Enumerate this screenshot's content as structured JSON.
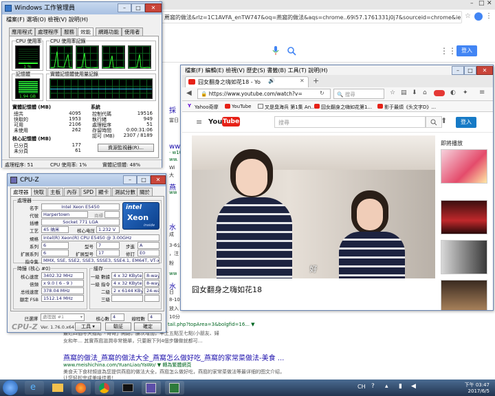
{
  "background": {
    "url": "薦窩的做法&rlz=1C1AVFA_enTW747&oq=燕窩的做法&aqs=chrome..69i57.1761331j0j7&sourceid=chrome&ie=UTF",
    "login": "登入",
    "snippets": [
      "採",
      "當日",
      "ww",
      "· w10",
      "ww.",
      "Wi",
      "大",
      "燕",
      "ww",
      "水",
      "成",
      "3-6公",
      "，注",
      "粉",
      "ww",
      "水",
      "日",
      "8-10",
      "放入",
      "10分",
      "tail.php?topArea=3&bolgfid=16... ▼",
      "最近四個冬天撥給「哥哥」開路，腰次增加，早上五點至七點(小朋友、婦",
      "女和年… 其實燕窩滋潤非常簡單，只要跟下列4個步驟做就都可…"
    ],
    "result_title": "燕窩的做法_燕窩的做法大全_燕窩怎么做好吃_燕窩的家常菜做法-美食 ...",
    "result_url": "www.meishichina.com/YuanLiao/YaWo/ ▼ 轉為繁體網頁",
    "result_desc1": "美食天下食材頻道為您提供燕窩的做法大全，燕窩怎么做好吃，燕窩的家常菜做法等最详细的图文介绍，",
    "result_desc2": "让您轻松完成美味佳肴！"
  },
  "taskmanager": {
    "title": "Windows 工作管理員",
    "menu": "檔案(F)  選項(O)  檢視(V)  說明(H)",
    "tabs": [
      "應用程式",
      "處理程序",
      "服務",
      "效能",
      "網路功能",
      "使用者"
    ],
    "active_tab": "效能",
    "cpu_usage_label": "CPU 使用率",
    "cpu_usage_value": "1 %",
    "cpu_history_label": "CPU 使用率記錄",
    "mem_label": "記憶體",
    "mem_value": "1.94 GB",
    "mem_history_label": "實體記憶體使用量記錄",
    "physical": {
      "header": "實體記憶體 (MB)",
      "rows": [
        {
          "label": "總共",
          "value": "4095"
        },
        {
          "label": "快取的",
          "value": "1953"
        },
        {
          "label": "可用",
          "value": "2106"
        },
        {
          "label": "未使用",
          "value": "262"
        }
      ]
    },
    "kernel": {
      "header": "核心記憶體 (MB)",
      "rows": [
        {
          "label": "已分頁",
          "value": "177"
        },
        {
          "label": "未分頁",
          "value": "61"
        }
      ]
    },
    "system": {
      "header": "系統",
      "rows": [
        {
          "label": "控制代碼",
          "value": "19516"
        },
        {
          "label": "執行緒",
          "value": "949"
        },
        {
          "label": "處理程序",
          "value": "51"
        },
        {
          "label": "存留時間",
          "value": "0:00:31:06"
        },
        {
          "label": "認可 (MB)",
          "value": "2307 / 8189"
        }
      ]
    },
    "resource_button": "資源監視器(R)...",
    "status": {
      "processes": "處理程序: 51",
      "cpu": "CPU 使用率: 1%",
      "memory": "實體記憶體: 48%"
    }
  },
  "cpuz": {
    "title": "CPU-Z",
    "tabs": [
      "處理器",
      "快取",
      "主板",
      "內存",
      "SPD",
      "顯卡",
      "測試分數",
      "關於"
    ],
    "processor_group": "處理器",
    "fields": {
      "name_label": "名字",
      "name": "Intel Xeon E5450",
      "codename_label": "代號",
      "codename": "Harpertown",
      "brand_label": "商標",
      "package_label": "插槽",
      "package": "Socket 771 LGA",
      "tech_label": "工艺",
      "tech": "45 纳米",
      "vcore_label": "核心电压",
      "vcore": "1.232 V",
      "spec_label": "規格",
      "spec": "Intel(R) Xeon(R) CPU          E5450  @ 3.00GHz",
      "family_label": "系列",
      "family": "6",
      "model_label": "型号",
      "model": "7",
      "stepping_label": "步進",
      "stepping": "A",
      "extfamily_label": "扩展系列",
      "extfamily": "6",
      "extmodel_label": "扩展型号",
      "extmodel": "17",
      "revision_label": "修訂",
      "revision": "E0",
      "instr_label": "指令集",
      "instr": "MMX, SSE, SSE2, SSE3, SSSE3, SSE4.1, EM64T, VT-x"
    },
    "clocks_group": "時鐘 (核心 #0)",
    "clocks": {
      "core_speed_label": "核心速度",
      "core_speed": "3402.32 MHz",
      "multiplier_label": "倍頻",
      "multiplier": "x 9.0 ( 6 - 9 )",
      "bus_label": "总线速度",
      "bus": "378.04 MHz",
      "fsb_label": "額定 FSB",
      "fsb": "1512.14 MHz"
    },
    "cache_group": "緩存",
    "cache": [
      {
        "label": "一級 數據",
        "size": "4 x 32 KBytes",
        "way": "8-way"
      },
      {
        "label": "一級 指令",
        "size": "4 x 32 KBytes",
        "way": "8-way"
      },
      {
        "label": "二級",
        "size": "2 x 6144 KBytes",
        "way": "24-way"
      },
      {
        "label": "三級",
        "size": "",
        "way": ""
      }
    ],
    "selected_label": "已選擇",
    "selected_value": "處理器 #1",
    "cores_label": "核心數",
    "cores": "4",
    "threads_label": "線程數",
    "threads": "4",
    "logo": "CPU-Z",
    "version": "Ver. 1.76.0.x64",
    "tools_button": "工具",
    "validate_button": "驗証",
    "ok_button": "確定",
    "intel_brand": "intel",
    "xeon_brand": "Xeon",
    "inside_text": "inside"
  },
  "firefox": {
    "menu": "檔案(F)  編輯(E)  檢視(V)  歷史(S)  書籤(B)  工具(T)  說明(H)",
    "tab_title": "囧女翻身之嗨如花18 - Yo",
    "url": "https://www.youtube.com/watch?v=",
    "search_placeholder": "搜尋",
    "bookmarks": [
      "Yahoo奇摩",
      "YouTube",
      "叉是臭海兵 第1集 An...",
      "囧女翻身之嗨如花第1...",
      "影于最煩《头文字D》..."
    ],
    "yt_search_placeholder": "搜尋",
    "yt_login": "登入",
    "subtitle": "好",
    "video_title": "囧女翻身之嗨如花18",
    "next_up": "即將播放"
  },
  "taskbar": {
    "lang": "CH",
    "time": "下午 03:47",
    "date": "2017/6/5"
  }
}
